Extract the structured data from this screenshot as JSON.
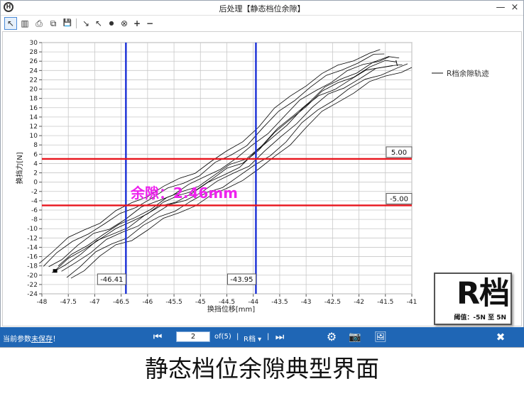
{
  "window": {
    "title": "后处理【静态档位余隙】",
    "app_icon": "H",
    "minimize": "—",
    "close": "×"
  },
  "toolbar": {
    "icons": [
      "pointer-icon",
      "columns-icon",
      "print-icon",
      "copy-icon",
      "save-icon",
      "cursor-a-icon",
      "cursor-b-icon",
      "dot-icon",
      "circle-x-icon",
      "plus-icon",
      "minus-icon"
    ],
    "glyphs": [
      "↖",
      "▥",
      "⎙",
      "⧉",
      "💾",
      "↘",
      "↖",
      "●",
      "⊗",
      "+",
      "−"
    ]
  },
  "chart_data": {
    "type": "line",
    "xlabel": "换挡位移[mm]",
    "ylabel": "换挡力[N]",
    "xlim": [
      -48,
      -41
    ],
    "ylim": [
      -24,
      30
    ],
    "x_ticks": [
      -48,
      -47.5,
      -47,
      -46.5,
      -46,
      -45.5,
      -45,
      -44.5,
      -44,
      -43.5,
      -43,
      -42.5,
      -42,
      -41.5,
      -41
    ],
    "y_ticks": [
      -24,
      -22,
      -20,
      -18,
      -16,
      -14,
      -12,
      -10,
      -8,
      -6,
      -4,
      -2,
      0,
      2,
      4,
      6,
      8,
      10,
      12,
      14,
      16,
      18,
      20,
      22,
      24,
      26,
      28,
      30
    ],
    "grid": true,
    "legend": {
      "position": "top-right",
      "entries": [
        "R档余隙轨迹"
      ]
    },
    "series": [
      {
        "name": "R档余隙轨迹",
        "color": "#000000",
        "x": [
          -47.75,
          -47.5,
          -47.2,
          -46.9,
          -46.6,
          -46.3,
          -46.0,
          -45.7,
          -45.4,
          -45.1,
          -44.8,
          -44.5,
          -44.2,
          -43.9,
          -43.6,
          -43.3,
          -43.0,
          -42.7,
          -42.4,
          -42.1,
          -41.8,
          -41.5,
          -41.3
        ],
        "y": [
          -19.0,
          -16.8,
          -14.2,
          -12.0,
          -10.4,
          -8.4,
          -6.4,
          -4.6,
          -3.0,
          -1.4,
          0.4,
          2.6,
          4.4,
          7.0,
          10.2,
          13.6,
          16.6,
          19.2,
          21.2,
          23.0,
          24.6,
          25.8,
          26.2
        ]
      }
    ],
    "reference_lines": {
      "horizontal": [
        {
          "y": 5.0,
          "label": "5.00",
          "color": "#e8141c"
        },
        {
          "y": -5.0,
          "label": "-5.00",
          "color": "#e8141c"
        }
      ],
      "vertical": [
        {
          "x": -46.41,
          "label": "-46.41",
          "color": "#1a2fd6"
        },
        {
          "x": -43.95,
          "label": "-43.95",
          "color": "#1a2fd6"
        }
      ]
    },
    "annotation": {
      "text": "余隙：2.46mm",
      "color": "#ee22ee"
    }
  },
  "badge": {
    "gear": "R档",
    "threshold": "阈值：-5N 至 5N"
  },
  "statusbar": {
    "params_prefix": "当前参数",
    "params_status": "未保存",
    "params_suffix": "！",
    "first_page": "⏮",
    "page_value": "2",
    "page_total": "of(5)",
    "sep1": "|",
    "gear_select": "R档",
    "gear_caret": "▾",
    "sep2": "|",
    "last_page": "⏭",
    "settings": "⚙",
    "camera": "📷",
    "image": "🖼",
    "close": "✖"
  },
  "caption": "静态档位余隙典型界面",
  "colors": {
    "status_bg": "#1f66b5",
    "red_line": "#e8141c",
    "blue_line": "#1a2fd6",
    "annotation": "#ee22ee"
  }
}
